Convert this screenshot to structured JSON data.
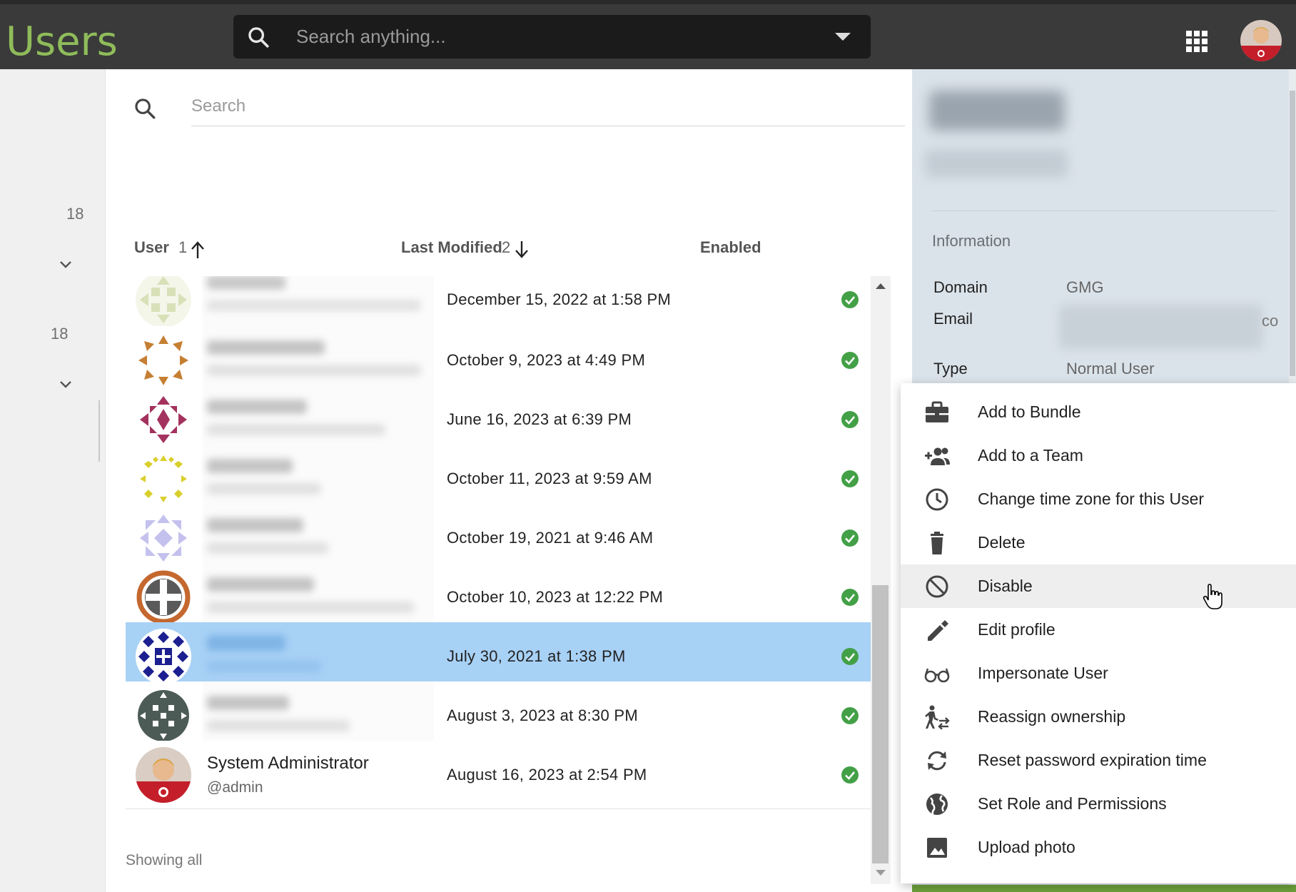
{
  "app": {
    "title": "Users"
  },
  "global_search": {
    "placeholder": "Search anything..."
  },
  "rail": {
    "count_top": "18",
    "count_bottom": "18"
  },
  "list": {
    "search_placeholder": "Search",
    "columns": {
      "user": "User",
      "user_sort_order": "1",
      "last_modified": "Last Modified",
      "last_modified_sort_order": "2",
      "enabled": "Enabled"
    },
    "rows": [
      {
        "modified": "December 15, 2022 at 1:58 PM",
        "enabled": true
      },
      {
        "modified": "October 9, 2023 at 4:49 PM",
        "enabled": true
      },
      {
        "modified": "June 16, 2023 at 6:39 PM",
        "enabled": true
      },
      {
        "modified": "October 11, 2023 at 9:59 AM",
        "enabled": true
      },
      {
        "modified": "October 19, 2021 at 9:46 AM",
        "enabled": true
      },
      {
        "modified": "October 10, 2023 at 12:22 PM",
        "enabled": true
      },
      {
        "modified": "July 30, 2021 at 1:38 PM",
        "enabled": true,
        "selected": true
      },
      {
        "modified": "August 3, 2023 at 8:30 PM",
        "enabled": true
      },
      {
        "name": "System Administrator",
        "handle": "@admin",
        "modified": "August 16, 2023 at 2:54 PM",
        "enabled": true
      }
    ],
    "footer": "Showing all"
  },
  "detail": {
    "section_title": "Information",
    "fields": {
      "domain_label": "Domain",
      "domain_value": "GMG",
      "email_label": "Email",
      "email_tail": "co",
      "type_label": "Type",
      "type_value": "Normal User"
    }
  },
  "context_menu": {
    "items": [
      {
        "label": "Add to Bundle",
        "icon": "briefcase-icon"
      },
      {
        "label": "Add to a Team",
        "icon": "group-add-icon"
      },
      {
        "label": "Change time zone for this User",
        "icon": "clock-icon"
      },
      {
        "label": "Delete",
        "icon": "trash-icon"
      },
      {
        "label": "Disable",
        "icon": "block-icon",
        "hovered": true
      },
      {
        "label": "Edit profile",
        "icon": "pencil-icon"
      },
      {
        "label": "Impersonate User",
        "icon": "glasses-icon"
      },
      {
        "label": "Reassign ownership",
        "icon": "walk-transfer-icon"
      },
      {
        "label": "Reset password expiration time",
        "icon": "refresh-icon"
      },
      {
        "label": "Set Role and Permissions",
        "icon": "globe-icon"
      },
      {
        "label": "Upload photo",
        "icon": "image-icon"
      }
    ]
  },
  "colors": {
    "brand": "#8fbc5a",
    "topbar": "#3a3a3a",
    "selected_row": "#a8d1f6",
    "check": "#43a047",
    "detail_panel": "#dbe3ea",
    "accent_green": "#6da13a"
  }
}
